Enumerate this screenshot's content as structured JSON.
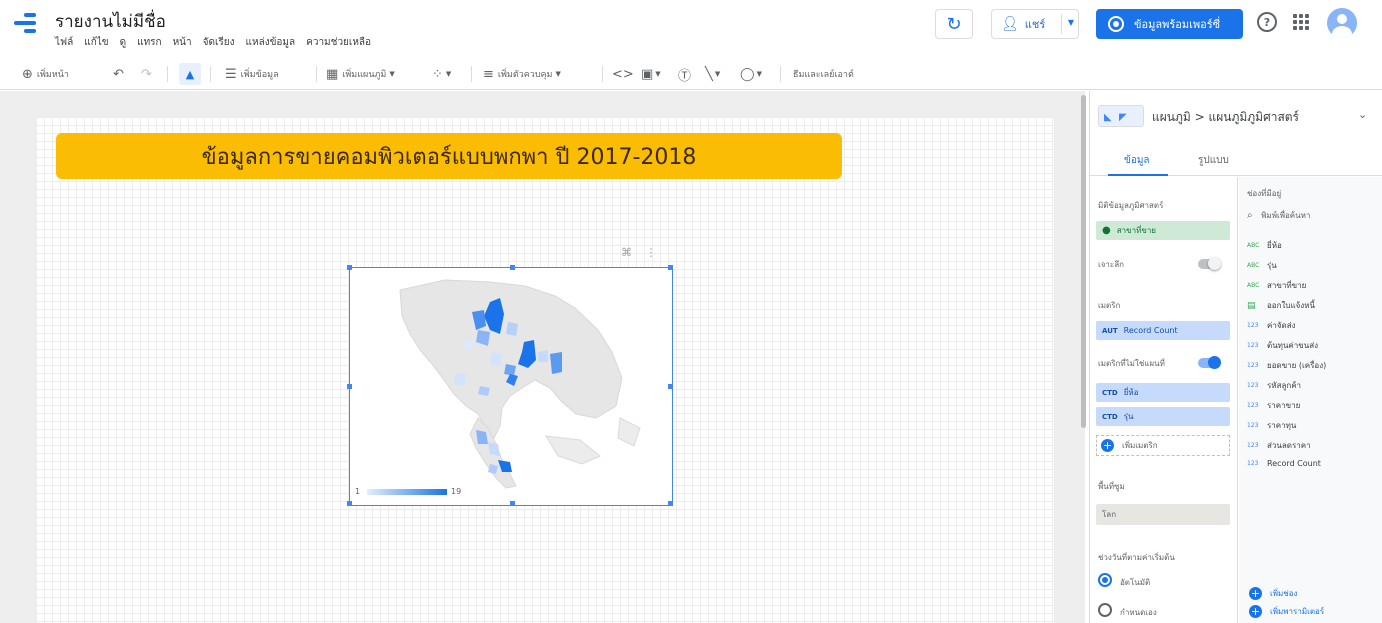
{
  "header": {
    "title": "รายงานไม่มีชื่อ",
    "menu": [
      "ไฟล์",
      "แก้ไข",
      "ดู",
      "แทรก",
      "หน้า",
      "จัดเรียง",
      "แหล่งข้อมูล",
      "ความช่วยเหลือ"
    ],
    "share_label": "แชร์",
    "view_label": "ข้อมูลพร้อมเพอร์ซี่",
    "accent_color": "#1a73e8"
  },
  "toolbar": {
    "add_page": "เพิ่มหน้า",
    "add_data": "เพิ่มข้อมูล",
    "add_chart": "เพิ่มแผนภูมิ",
    "add_control": "เพิ่มตัวควบคุม",
    "theme_layout": "ธีมและเลย์เอาต์"
  },
  "canvas": {
    "banner_title": "ข้อมูลการขายคอมพิวเตอร์แบบพกพา ปี 2017-2018",
    "banner_color": "#fbbc04",
    "legend_min": "1",
    "legend_max": "19",
    "map_color_low": "#e3eefc",
    "map_color_high": "#1a73e8"
  },
  "panel": {
    "chart_type": "แผนภูมิ > แผนภูมิภูมิศาสตร์",
    "tabs": [
      "ข้อมูล",
      "รูปแบบ"
    ],
    "geo_dim_label": "มิติข้อมูลภูมิศาสตร์",
    "geo_dim_value": "สาขาที่ขาย",
    "drilldown_label": "เจาะลึก",
    "metric_label": "เมตริก",
    "metric_value": "Record Count",
    "metric_tag": "AUT",
    "tooltip_metric_label": "เมตริกที่ไม่ใช่แผนที่",
    "extra_metrics": [
      {
        "tag": "CTD",
        "label": "ยี่ห้อ"
      },
      {
        "tag": "CTD",
        "label": "รุ่น"
      }
    ],
    "add_metric": "เพิ่มเมตริก",
    "zoom_label": "พื้นที่ซูม",
    "zoom_value": "โลก",
    "date_range_label": "ช่วงวันที่ตามค่าเริ่มต้น",
    "date_auto": "อัตโนมัติ",
    "date_custom": "กำหนดเอง"
  },
  "fields": {
    "header": "ช่องที่มีอยู่",
    "search_placeholder": "พิมพ์เพื่อค้นหา",
    "items": [
      {
        "type": "ABC",
        "label": "ยี่ห้อ"
      },
      {
        "type": "ABC",
        "label": "รุ่น"
      },
      {
        "type": "ABC",
        "label": "สาขาที่ขาย"
      },
      {
        "type": "CAL",
        "label": "ออกใบแจ้งหนี้"
      },
      {
        "type": "123",
        "label": "ค่าจัดส่ง"
      },
      {
        "type": "123",
        "label": "ต้นทุนค่าขนส่ง"
      },
      {
        "type": "123",
        "label": "ยอดขาย (เครื่อง)"
      },
      {
        "type": "123",
        "label": "รหัสลูกค้า"
      },
      {
        "type": "123",
        "label": "ราคาขาย"
      },
      {
        "type": "123",
        "label": "ราคาทุน"
      },
      {
        "type": "123",
        "label": "ส่วนลดราคา"
      },
      {
        "type": "123",
        "label": "Record Count"
      }
    ],
    "add_field": "เพิ่มช่อง",
    "add_parameter": "เพิ่มพารามิเตอร์"
  }
}
